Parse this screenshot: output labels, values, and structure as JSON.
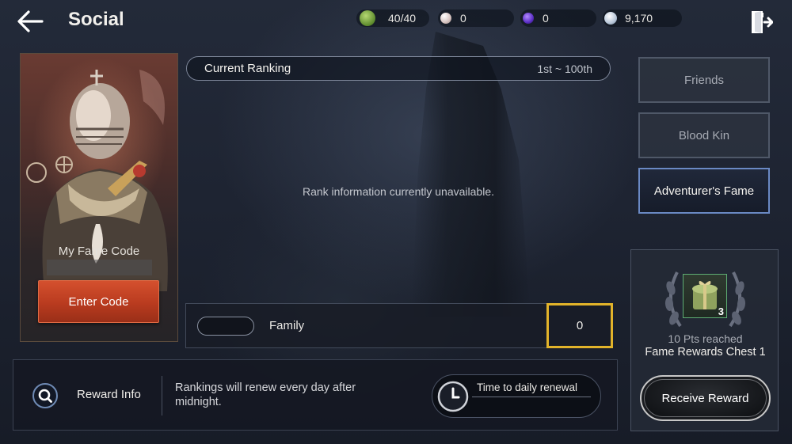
{
  "header": {
    "title": "Social",
    "resources": [
      {
        "icon": "energy-icon",
        "value": "40/40",
        "color": "#7fb24a"
      },
      {
        "icon": "pearl-icon",
        "value": "0",
        "color": "#e7d6d3"
      },
      {
        "icon": "dark-orb-icon",
        "value": "0",
        "color": "#6b3fd0"
      },
      {
        "icon": "silver-coin-icon",
        "value": "9,170",
        "color": "#c9d6e6"
      }
    ]
  },
  "profile": {
    "fame_code_label": "My Fame Code",
    "enter_code_label": "Enter Code"
  },
  "ranking": {
    "title": "Current Ranking",
    "range": "1st ~ 100th",
    "message": "Rank information currently unavailable."
  },
  "family": {
    "label": "Family",
    "score": "0"
  },
  "info": {
    "reward_info_label": "Reward Info",
    "renew_text": "Rankings will renew every day after midnight.",
    "timer_label": "Time to daily renewal"
  },
  "tabs": [
    {
      "label": "Friends",
      "active": false
    },
    {
      "label": "Blood Kin",
      "active": false
    },
    {
      "label": "Adventurer's Fame",
      "active": true
    }
  ],
  "reward": {
    "chest_count": "3",
    "pts_reached": "10 Pts reached",
    "chest_name": "Fame Rewards Chest 1",
    "receive_label": "Receive Reward"
  },
  "colors": {
    "accent_orange": "#c4441f",
    "highlight_yellow": "#e2b32a",
    "active_tab_border": "#6a89c4"
  }
}
